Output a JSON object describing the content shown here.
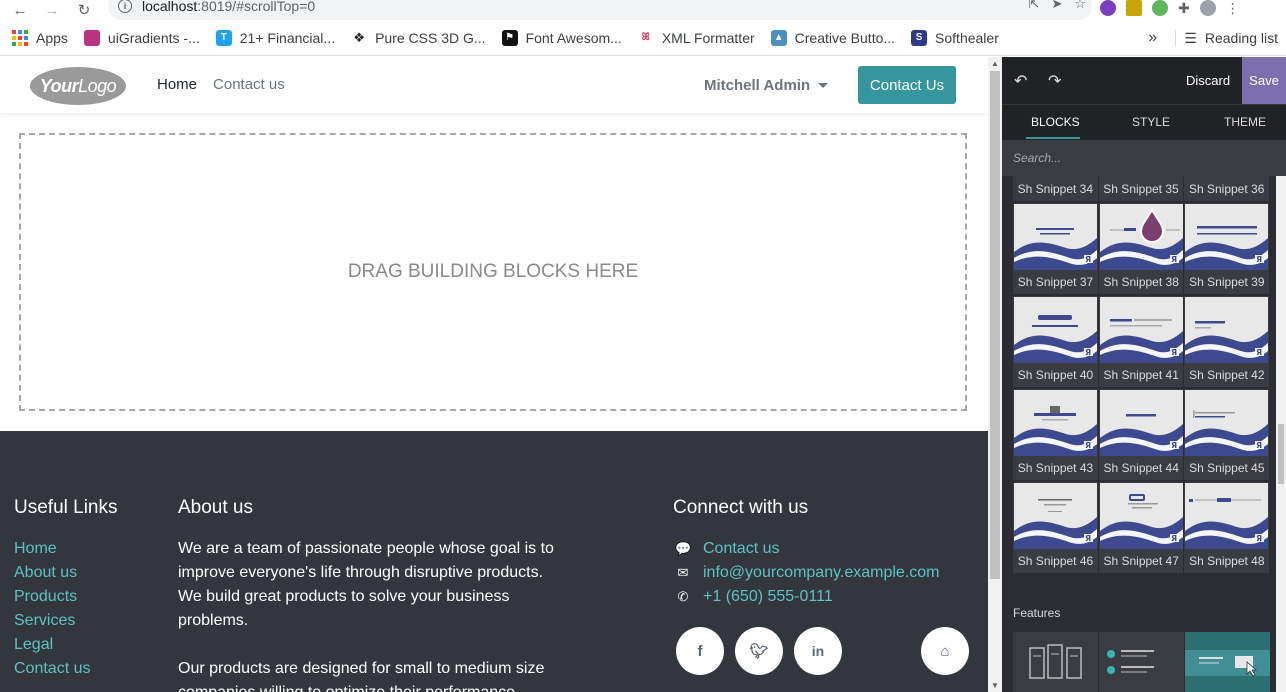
{
  "browser": {
    "url_host": "localhost",
    "url_rest": ":8019/#scrollTop=0",
    "bookmarks": [
      {
        "label": "Apps",
        "color": "#4285f4"
      },
      {
        "label": "uiGradients -...",
        "color": "#b83280"
      },
      {
        "label": "21+ Financial...",
        "color": "#1da1f2"
      },
      {
        "label": "Pure CSS 3D G...",
        "color": "#222222"
      },
      {
        "label": "Font Awesom...",
        "color": "#111111"
      },
      {
        "label": "XML Formatter",
        "color": "#d0436a"
      },
      {
        "label": "Creative Butto...",
        "color": "#4a90c4"
      },
      {
        "label": "Softhealer",
        "color": "#2b3a8a"
      }
    ],
    "more": "»",
    "reading_list": "Reading list"
  },
  "site": {
    "logo_bold": "Your",
    "logo_rest": "Logo",
    "menu": {
      "home": "Home",
      "contact": "Contact us"
    },
    "user": "Mitchell Admin",
    "contact_button": "Contact Us",
    "dropzone": "DRAG BUILDING BLOCKS HERE",
    "footer": {
      "useful_links_title": "Useful Links",
      "links": [
        "Home",
        "About us",
        "Products",
        "Services",
        "Legal",
        "Contact us"
      ],
      "about_title": "About us",
      "about_p1": "We are a team of passionate people whose goal is to improve everyone's life through disruptive products. We build great products to solve your business problems.",
      "about_p2": "Our products are designed for small to medium size companies willing to optimize their performance.",
      "connect_title": "Connect with us",
      "contact_link": "Contact us",
      "email": "info@yourcompany.example.com",
      "phone": "+1 (650) 555-0111"
    }
  },
  "editor": {
    "discard": "Discard",
    "save": "Save",
    "tabs": {
      "blocks": "BLOCKS",
      "style": "STYLE",
      "theme": "THEME"
    },
    "search_placeholder": "Search...",
    "top_row": [
      "Sh Snippet 34",
      "Sh Snippet 35",
      "Sh Snippet 36"
    ],
    "snippets": [
      [
        "Sh Snippet 37",
        "Sh Snippet 38",
        "Sh Snippet 39"
      ],
      [
        "Sh Snippet 40",
        "Sh Snippet 41",
        "Sh Snippet 42"
      ],
      [
        "Sh Snippet 43",
        "Sh Snippet 44",
        "Sh Snippet 45"
      ],
      [
        "Sh Snippet 46",
        "Sh Snippet 47",
        "Sh Snippet 48"
      ]
    ],
    "features_title": "Features"
  },
  "colors": {
    "teal": "#35979c",
    "link": "#5bc3c4",
    "footer_bg": "#33363c",
    "wave": "#3d4a8f",
    "save": "#7c6fb0"
  }
}
